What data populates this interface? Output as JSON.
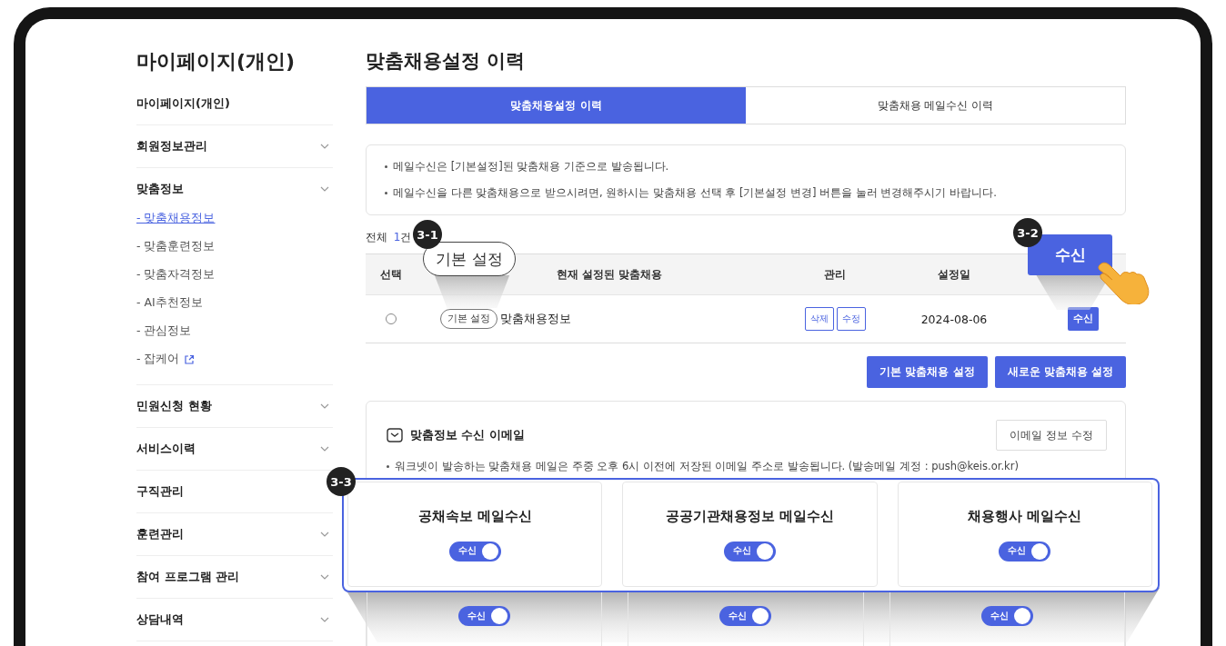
{
  "sidebar": {
    "title": "마이페이지(개인)",
    "items": [
      {
        "label": "마이페이지(개인)",
        "expandable": false
      },
      {
        "label": "회원정보관리",
        "expandable": true
      },
      {
        "label": "맞춤정보",
        "expandable": true,
        "children": [
          {
            "label": "- 맞춤채용정보",
            "selected": true,
            "external": false
          },
          {
            "label": "- 맞춤훈련정보",
            "selected": false,
            "external": false
          },
          {
            "label": "- 맞춤자격정보",
            "selected": false,
            "external": false
          },
          {
            "label": "- AI추천정보",
            "selected": false,
            "external": false
          },
          {
            "label": "- 관심정보",
            "selected": false,
            "external": false
          },
          {
            "label": "- 잡케어",
            "selected": false,
            "external": true
          }
        ]
      },
      {
        "label": "민원신청 현황",
        "expandable": true
      },
      {
        "label": "서비스이력",
        "expandable": true
      },
      {
        "label": "구직관리",
        "expandable": false
      },
      {
        "label": "훈련관리",
        "expandable": true
      },
      {
        "label": "참여 프로그램 관리",
        "expandable": true
      },
      {
        "label": "상담내역",
        "expandable": true
      }
    ]
  },
  "page_title": "맞춤채용설정 이력",
  "tabs": [
    {
      "label": "맞춤채용설정 이력",
      "selected": true
    },
    {
      "label": "맞춤채용 메일수신 이력",
      "selected": false
    }
  ],
  "notices": [
    "메일수신은 [기본설정]된 맞춤채용 기준으로 발송됩니다.",
    "메일수신을 다른 맞춤채용으로 받으시려면, 원하시는 맞춤채용 선택 후 [기본설정 변경] 버튼을 눌러 변경해주시기 바랍니다."
  ],
  "total": {
    "label": "전체",
    "count": "1",
    "unit": "건"
  },
  "table": {
    "columns": [
      "선택",
      "현재 설정된 맞춤채용",
      "관리",
      "설정일"
    ],
    "rows": [
      {
        "selected": false,
        "tag": "기본 설정",
        "name": "맞춤채용정보",
        "actions": [
          "삭제",
          "수정"
        ],
        "date": "2024-08-06",
        "receive": "수신"
      }
    ]
  },
  "buttons": [
    "기본 맞춤채용 설정",
    "새로운 맞춤채용 설정"
  ],
  "email_section": {
    "title": "맞춤정보 수신 이메일",
    "edit_button": "이메일 정보 수정",
    "note": "워크넷이 발송하는 맞춤채용 메일은 주중 오후 6시 이전에 저장된 이메일 주소로 발송됩니다. (발송메일 계정 : push@keis.or.kr)",
    "lower_toggles": [
      {
        "label": "수신",
        "on": true
      },
      {
        "label": "수신",
        "on": true
      },
      {
        "label": "수신",
        "on": true
      }
    ]
  },
  "callouts": [
    {
      "badge": "3-1",
      "text": "기본 설정"
    },
    {
      "badge": "3-2",
      "text": "수신"
    },
    {
      "badge": "3-3",
      "cards": [
        {
          "title": "공채속보 메일수신",
          "toggle": "수신",
          "on": true
        },
        {
          "title": "공공기관채용정보 메일수신",
          "toggle": "수신",
          "on": true
        },
        {
          "title": "채용행사 메일수신",
          "toggle": "수신",
          "on": true
        }
      ]
    }
  ]
}
